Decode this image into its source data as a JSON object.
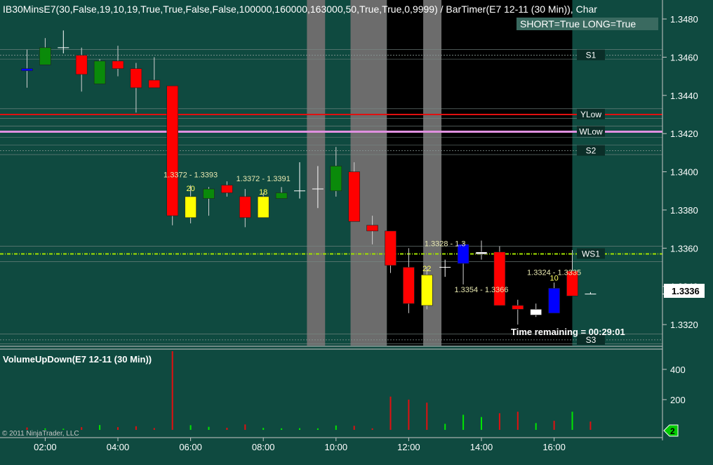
{
  "title": "IB30MinsE7(30,False,19,10,19,True,True,False,False,100000,160000,163000,50,True,True,0,9999)  /  BarTimer(E7  12-11  (30  Min)),  Char",
  "badge": "SHORT=True LONG=True",
  "timer_text": "Time remaining = 00:29:01",
  "price_panel": {
    "ticks": [
      "1.3480",
      "1.3460",
      "1.3440",
      "1.3420",
      "1.3400",
      "1.3380",
      "1.3360",
      "1.3340",
      "1.3320"
    ],
    "last_price": "1.3336",
    "last_price_value": 1.3336
  },
  "volume_panel": {
    "title": "VolumeUpDown(E7 12-11 (30 Min))",
    "ticks": [
      "400",
      "200"
    ],
    "badge": "2"
  },
  "x_ticks": [
    "02:00",
    "04:00",
    "06:00",
    "08:00",
    "10:00",
    "12:00",
    "14:00",
    "16:00"
  ],
  "copyright": "© 2011 NinjaTrader, LLC",
  "colors": {
    "background": "#0f4a40",
    "up_candle": "#0a8a0a",
    "down_candle": "#ff0000",
    "ib_candle": "#ffff00",
    "blue_candle": "#0000ff",
    "white_candle": "#ffffff",
    "vol_up": "#00e600",
    "vol_down": "#e01010",
    "ylow": "#e01010",
    "wlow": "#e090e0",
    "ws1": "#a0e000"
  },
  "chart_data": {
    "type": "candlestick",
    "y_range": [
      1.3309,
      1.3487
    ],
    "volume_range": [
      0,
      520
    ],
    "x_labels": [
      "02:00",
      "04:00",
      "06:00",
      "08:00",
      "10:00",
      "12:00",
      "14:00",
      "16:00"
    ],
    "candles": [
      {
        "o": 1.3454,
        "h": 1.3464,
        "l": 1.3444,
        "c": 1.3454,
        "color": "blue",
        "vol": 16,
        "vdir": "down"
      },
      {
        "o": 1.3456,
        "h": 1.347,
        "l": 1.3456,
        "c": 1.3465,
        "color": "green",
        "vol": 10,
        "vdir": "up"
      },
      {
        "o": 1.3465,
        "h": 1.3474,
        "l": 1.3462,
        "c": 1.3465,
        "color": "flat",
        "vol": 8,
        "vdir": "up"
      },
      {
        "o": 1.3461,
        "h": 1.3465,
        "l": 1.3442,
        "c": 1.3451,
        "color": "red",
        "vol": 18,
        "vdir": "down"
      },
      {
        "o": 1.3446,
        "h": 1.3459,
        "l": 1.3446,
        "c": 1.3458,
        "color": "green",
        "vol": 32,
        "vdir": "up"
      },
      {
        "o": 1.3458,
        "h": 1.3466,
        "l": 1.345,
        "c": 1.3454,
        "color": "red",
        "vol": 18,
        "vdir": "down"
      },
      {
        "o": 1.3454,
        "h": 1.3457,
        "l": 1.3431,
        "c": 1.3444,
        "color": "red",
        "vol": 24,
        "vdir": "down"
      },
      {
        "o": 1.3448,
        "h": 1.346,
        "l": 1.3444,
        "c": 1.3444,
        "color": "red",
        "vol": 12,
        "vdir": "down"
      },
      {
        "o": 1.3445,
        "h": 1.3445,
        "l": 1.3372,
        "c": 1.3377,
        "color": "red",
        "vol": 520,
        "vdir": "down"
      },
      {
        "o": 1.3376,
        "h": 1.3393,
        "l": 1.3373,
        "c": 1.3387,
        "color": "yellow",
        "vol": 31,
        "vdir": "up"
      },
      {
        "o": 1.3386,
        "h": 1.3392,
        "l": 1.3377,
        "c": 1.3391,
        "color": "green",
        "vol": 20,
        "vdir": "up"
      },
      {
        "o": 1.3393,
        "h": 1.3395,
        "l": 1.3387,
        "c": 1.3389,
        "color": "red",
        "vol": 14,
        "vdir": "down"
      },
      {
        "o": 1.3387,
        "h": 1.3391,
        "l": 1.3371,
        "c": 1.3376,
        "color": "red",
        "vol": 36,
        "vdir": "down"
      },
      {
        "o": 1.3376,
        "h": 1.3389,
        "l": 1.3376,
        "c": 1.3387,
        "color": "yellow",
        "vol": 13,
        "vdir": "up"
      },
      {
        "o": 1.3386,
        "h": 1.3392,
        "l": 1.3386,
        "c": 1.3389,
        "color": "green",
        "vol": 10,
        "vdir": "up"
      },
      {
        "o": 1.3395,
        "h": 1.3405,
        "l": 1.3386,
        "c": 1.339,
        "color": "flat",
        "vol": 11,
        "vdir": "up"
      },
      {
        "o": 1.3391,
        "h": 1.3403,
        "l": 1.3381,
        "c": 1.3391,
        "color": "flat",
        "vol": 10,
        "vdir": "up"
      },
      {
        "o": 1.339,
        "h": 1.3413,
        "l": 1.3387,
        "c": 1.3403,
        "color": "green",
        "vol": 29,
        "vdir": "up"
      },
      {
        "o": 1.34,
        "h": 1.3405,
        "l": 1.3374,
        "c": 1.3374,
        "color": "red",
        "vol": 27,
        "vdir": "down"
      },
      {
        "o": 1.3372,
        "h": 1.3377,
        "l": 1.3362,
        "c": 1.3369,
        "color": "red",
        "vol": 10,
        "vdir": "down"
      },
      {
        "o": 1.3369,
        "h": 1.3369,
        "l": 1.3347,
        "c": 1.3351,
        "color": "red",
        "vol": 220,
        "vdir": "down"
      },
      {
        "o": 1.335,
        "h": 1.336,
        "l": 1.3326,
        "c": 1.3331,
        "color": "red",
        "vol": 200,
        "vdir": "down"
      },
      {
        "o": 1.333,
        "h": 1.335,
        "l": 1.3328,
        "c": 1.3346,
        "color": "yellow",
        "vol": 180,
        "vdir": "down"
      },
      {
        "o": 1.335,
        "h": 1.3354,
        "l": 1.3345,
        "c": 1.335,
        "color": "flat",
        "vol": 40,
        "vdir": "up"
      },
      {
        "o": 1.3352,
        "h": 1.3363,
        "l": 1.3341,
        "c": 1.3362,
        "color": "blue",
        "vol": 100,
        "vdir": "up"
      },
      {
        "o": 1.3358,
        "h": 1.3364,
        "l": 1.3354,
        "c": 1.3357,
        "color": "white",
        "vol": 85,
        "vdir": "up"
      },
      {
        "o": 1.3358,
        "h": 1.3361,
        "l": 1.333,
        "c": 1.333,
        "color": "red",
        "vol": 110,
        "vdir": "down"
      },
      {
        "o": 1.333,
        "h": 1.3333,
        "l": 1.332,
        "c": 1.3328,
        "color": "red",
        "vol": 120,
        "vdir": "down"
      },
      {
        "o": 1.3325,
        "h": 1.3331,
        "l": 1.3324,
        "c": 1.3328,
        "color": "white",
        "vol": 45,
        "vdir": "up"
      },
      {
        "o": 1.3326,
        "h": 1.3342,
        "l": 1.3326,
        "c": 1.3339,
        "color": "blue",
        "vol": 60,
        "vdir": "down"
      },
      {
        "o": 1.3335,
        "h": 1.3359,
        "l": 1.3335,
        "c": 1.3348,
        "color": "red",
        "vol": 120,
        "vdir": "up"
      },
      {
        "o": 1.3336,
        "h": 1.3337,
        "l": 1.3336,
        "c": 1.3336,
        "color": "flat",
        "vol": 55,
        "vdir": "down"
      }
    ],
    "shaded_periods": [
      {
        "from": 15.4,
        "to": 16.4,
        "style": "gray"
      },
      {
        "from": 17.8,
        "to": 19.8,
        "style": "gray"
      },
      {
        "from": 19.8,
        "to": 30.0,
        "style": "black"
      },
      {
        "from": 21.8,
        "to": 22.8,
        "style": "gray"
      }
    ],
    "levels": [
      {
        "label": "S1",
        "value": 1.3461,
        "style": "dotted-gray"
      },
      {
        "label": "YLow",
        "value": 1.343,
        "style": "solid-red"
      },
      {
        "label": "WLow",
        "value": 1.3421,
        "style": "solid-pink"
      },
      {
        "label": "S2",
        "value": 1.3411,
        "style": "dotted-gray"
      },
      {
        "label": "WS1",
        "value": 1.3357,
        "style": "dashdot-green"
      },
      {
        "label": "S3",
        "value": 1.3312,
        "style": "dotted-gray"
      }
    ],
    "annotations": [
      {
        "text": "1.3372 - 1.3393",
        "bar": 9,
        "value": 1.3397,
        "color": "#e8e8b0"
      },
      {
        "text": "20",
        "bar": 9,
        "value": 1.339,
        "color": "#ffff60"
      },
      {
        "text": "1.3372 - 1.3391",
        "bar": 13,
        "value": 1.3395,
        "color": "#e8e8b0"
      },
      {
        "text": "18",
        "bar": 13,
        "value": 1.3388,
        "color": "#ffff60"
      },
      {
        "text": "1.3328 - 1.3",
        "bar": 23,
        "value": 1.3361,
        "color": "#e8e8b0"
      },
      {
        "text": "22",
        "bar": 22,
        "value": 1.3348,
        "color": "#ffff60"
      },
      {
        "text": "1.3354 - 1.3366",
        "bar": 25,
        "value": 1.3337,
        "color": "#e8e8b0"
      },
      {
        "text": "1.3324 - 1.3335",
        "bar": 29,
        "value": 1.3346,
        "color": "#e8e8b0"
      },
      {
        "text": "10",
        "bar": 29,
        "value": 1.3343,
        "color": "#ffff60"
      }
    ]
  }
}
